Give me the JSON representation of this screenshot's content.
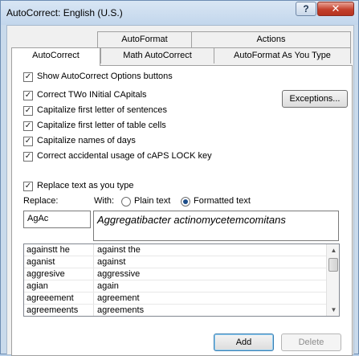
{
  "window": {
    "title": "AutoCorrect: English (U.S.)",
    "help_label": "?",
    "close_label": "✕"
  },
  "tabs": {
    "back": [
      "AutoFormat",
      "Actions"
    ],
    "front": [
      "AutoCorrect",
      "Math AutoCorrect",
      "AutoFormat As You Type"
    ],
    "active": "AutoCorrect"
  },
  "options": {
    "show_buttons": "Show AutoCorrect Options buttons",
    "two_initial_caps": "Correct TWo INitial CApitals",
    "first_letter_sentences": "Capitalize first letter of sentences",
    "first_letter_table_cells": "Capitalize first letter of table cells",
    "names_of_days": "Capitalize names of days",
    "caps_lock": "Correct accidental usage of cAPS LOCK key",
    "replace_as_you_type": "Replace text as you type",
    "exceptions_label": "Exceptions..."
  },
  "replace": {
    "replace_label": "Replace:",
    "with_label": "With:",
    "plain_text_label": "Plain text",
    "formatted_text_label": "Formatted text",
    "replace_value": "AgAc",
    "with_value": "Aggregatibacter actinomycetemcomitans"
  },
  "entries": [
    {
      "replace": "againstt he",
      "with": "against the"
    },
    {
      "replace": "aganist",
      "with": "against"
    },
    {
      "replace": "aggresive",
      "with": "aggressive"
    },
    {
      "replace": "agian",
      "with": "again"
    },
    {
      "replace": "agreeement",
      "with": "agreement"
    },
    {
      "replace": "agreemeents",
      "with": "agreements"
    }
  ],
  "buttons": {
    "add": "Add",
    "delete": "Delete"
  }
}
